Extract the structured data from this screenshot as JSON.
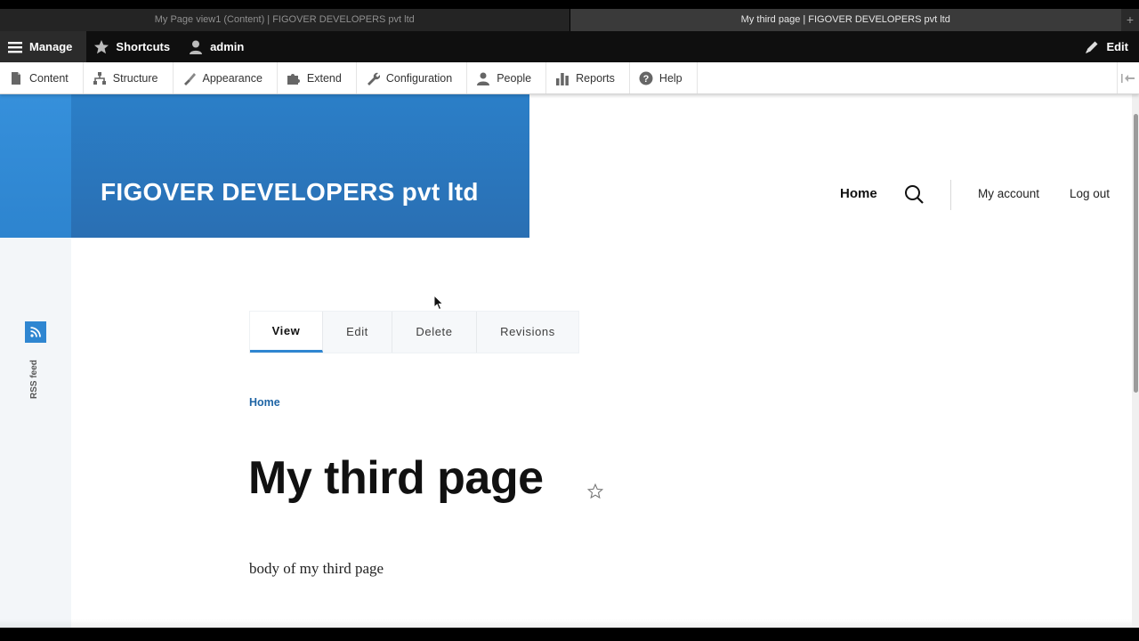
{
  "browser": {
    "tabs": [
      {
        "title": "My Page view1 (Content) | FIGOVER DEVELOPERS pvt ltd",
        "active": false
      },
      {
        "title": "My third page | FIGOVER DEVELOPERS pvt ltd",
        "active": true
      }
    ],
    "new_tab_label": "+"
  },
  "toolbar": {
    "manage_label": "Manage",
    "shortcuts_label": "Shortcuts",
    "user_label": "admin",
    "edit_label": "Edit"
  },
  "admin_menu": {
    "items": [
      {
        "label": "Content",
        "icon": "file-icon"
      },
      {
        "label": "Structure",
        "icon": "structure-icon"
      },
      {
        "label": "Appearance",
        "icon": "brush-icon"
      },
      {
        "label": "Extend",
        "icon": "puzzle-icon"
      },
      {
        "label": "Configuration",
        "icon": "wrench-icon"
      },
      {
        "label": "People",
        "icon": "people-icon"
      },
      {
        "label": "Reports",
        "icon": "bar-chart-icon"
      },
      {
        "label": "Help",
        "icon": "help-icon"
      }
    ]
  },
  "site": {
    "name": "FIGOVER DEVELOPERS pvt ltd",
    "header_color": "#2b7fc8"
  },
  "main_nav": {
    "home": "Home",
    "my_account": "My account",
    "log_out": "Log out"
  },
  "sidebar": {
    "rss_label": "RSS feed"
  },
  "tasks": [
    {
      "label": "View",
      "active": true
    },
    {
      "label": "Edit",
      "active": false
    },
    {
      "label": "Delete",
      "active": false
    },
    {
      "label": "Revisions",
      "active": false
    }
  ],
  "breadcrumb": {
    "home": "Home"
  },
  "node": {
    "title": "My third page",
    "body": "body of my third page"
  },
  "colors": {
    "accent": "#2f86d1",
    "link": "#1f65a5",
    "toolbar_bg": "#0f0f0f"
  }
}
